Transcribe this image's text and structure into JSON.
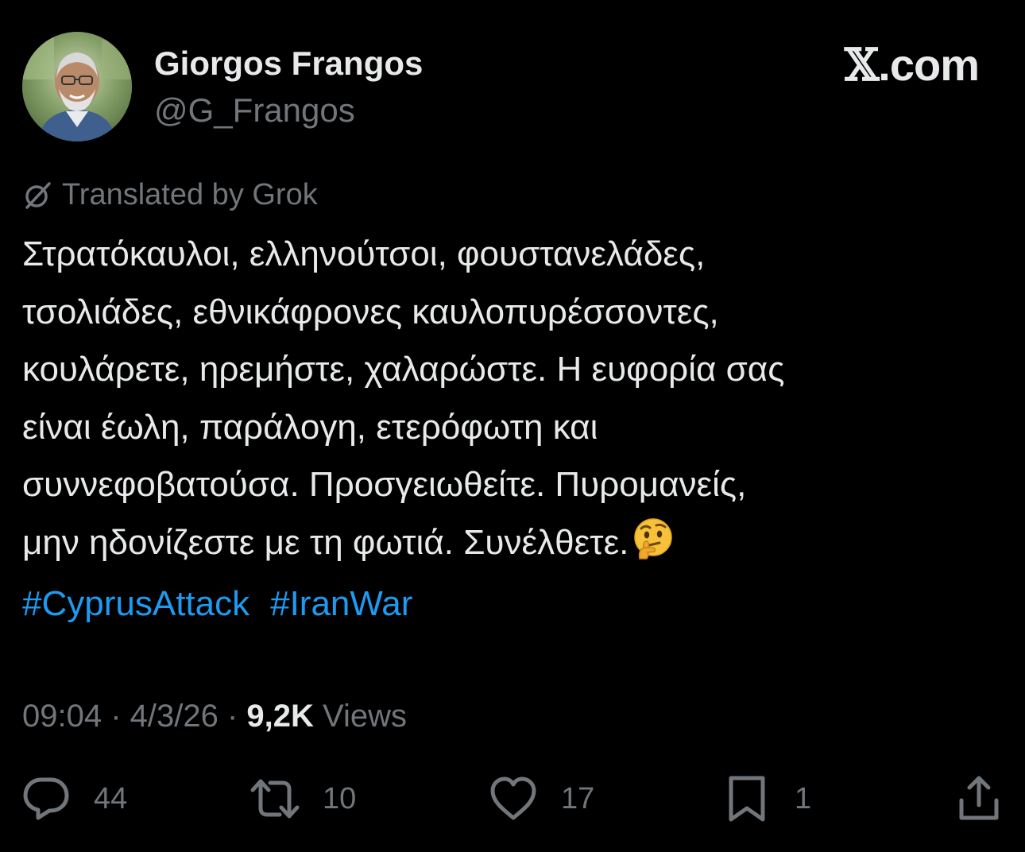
{
  "author": {
    "display_name": "Giorgos Frangos",
    "handle": "@G_Frangos"
  },
  "brand": {
    "logo_glyph": "𝕏",
    "logo_suffix": ".com"
  },
  "translation": {
    "icon": "grok-icon",
    "label": "Translated by Grok"
  },
  "tweet": {
    "lines": [
      "Στρατόκαυλοι, ελληνούτσοι, φουστανελάδες,",
      "τσολιάδες, εθνικάφρονες καυλοπυρέσσοντες,",
      "κουλάρετε, ηρεμήστε, χαλαρώστε. Η ευφορία σας",
      "είναι έωλη, παράλογη, ετερόφωτη και",
      "συννεφοβατούσα. Προσγειωθείτε. Πυρομανείς,",
      "μην ηδονίζεστε με τη φωτιά. Συνέλθετε."
    ],
    "emoji": "thinking-face",
    "hashtags": [
      "#CyprusAttack",
      "#IranWar"
    ]
  },
  "meta": {
    "time": "09:04",
    "separator": " · ",
    "date": "4/3/26",
    "views_count": "9,2K",
    "views_label": " Views"
  },
  "actions": {
    "reply": {
      "icon": "reply-icon",
      "count": "44"
    },
    "repost": {
      "icon": "repost-icon",
      "count": "10"
    },
    "like": {
      "icon": "heart-icon",
      "count": "17"
    },
    "bookmark": {
      "icon": "bookmark-icon",
      "count": "1"
    },
    "share": {
      "icon": "share-icon"
    }
  },
  "colors": {
    "background": "#000000",
    "text_primary": "#e7e9ea",
    "text_secondary": "#71767b",
    "link": "#1d9bf0"
  }
}
